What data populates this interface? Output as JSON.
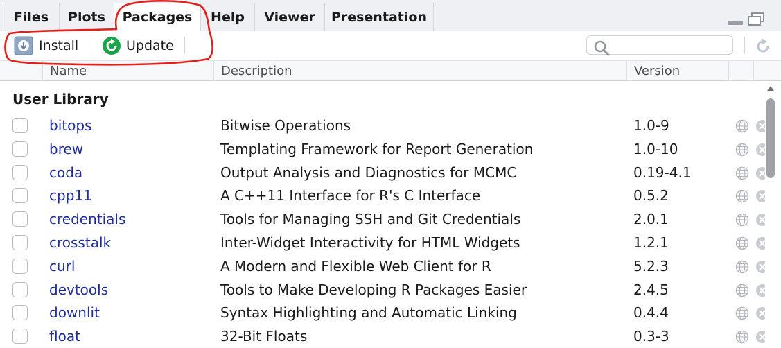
{
  "tabs": [
    {
      "label": "Files"
    },
    {
      "label": "Plots"
    },
    {
      "label": "Packages"
    },
    {
      "label": "Help"
    },
    {
      "label": "Viewer"
    },
    {
      "label": "Presentation"
    }
  ],
  "active_tab": "Packages",
  "toolbar": {
    "install_label": "Install",
    "update_label": "Update",
    "search_placeholder": "",
    "search_value": ""
  },
  "columns": {
    "name": "Name",
    "description": "Description",
    "version": "Version"
  },
  "library_title": "User Library",
  "packages": [
    {
      "name": "bitops",
      "description": "Bitwise Operations",
      "version": "1.0-9"
    },
    {
      "name": "brew",
      "description": "Templating Framework for Report Generation",
      "version": "1.0-10"
    },
    {
      "name": "coda",
      "description": "Output Analysis and Diagnostics for MCMC",
      "version": "0.19-4.1"
    },
    {
      "name": "cpp11",
      "description": "A C++11 Interface for R's C Interface",
      "version": "0.5.2"
    },
    {
      "name": "credentials",
      "description": "Tools for Managing SSH and Git Credentials",
      "version": "2.0.1"
    },
    {
      "name": "crosstalk",
      "description": "Inter-Widget Interactivity for HTML Widgets",
      "version": "1.2.1"
    },
    {
      "name": "curl",
      "description": "A Modern and Flexible Web Client for R",
      "version": "5.2.3"
    },
    {
      "name": "devtools",
      "description": "Tools to Make Developing R Packages Easier",
      "version": "2.4.5"
    },
    {
      "name": "downlit",
      "description": "Syntax Highlighting and Automatic Linking",
      "version": "0.4.4"
    },
    {
      "name": "float",
      "description": "32-Bit Floats",
      "version": "0.3-3"
    }
  ],
  "colors": {
    "package_link": "#1f2d9c",
    "annotation": "#e0211b",
    "update_icon": "#1aa34a"
  },
  "icons": {
    "install": "install-icon",
    "update": "update-icon",
    "search": "search-icon",
    "refresh": "refresh-icon",
    "homepage": "globe-icon",
    "remove": "remove-icon"
  }
}
